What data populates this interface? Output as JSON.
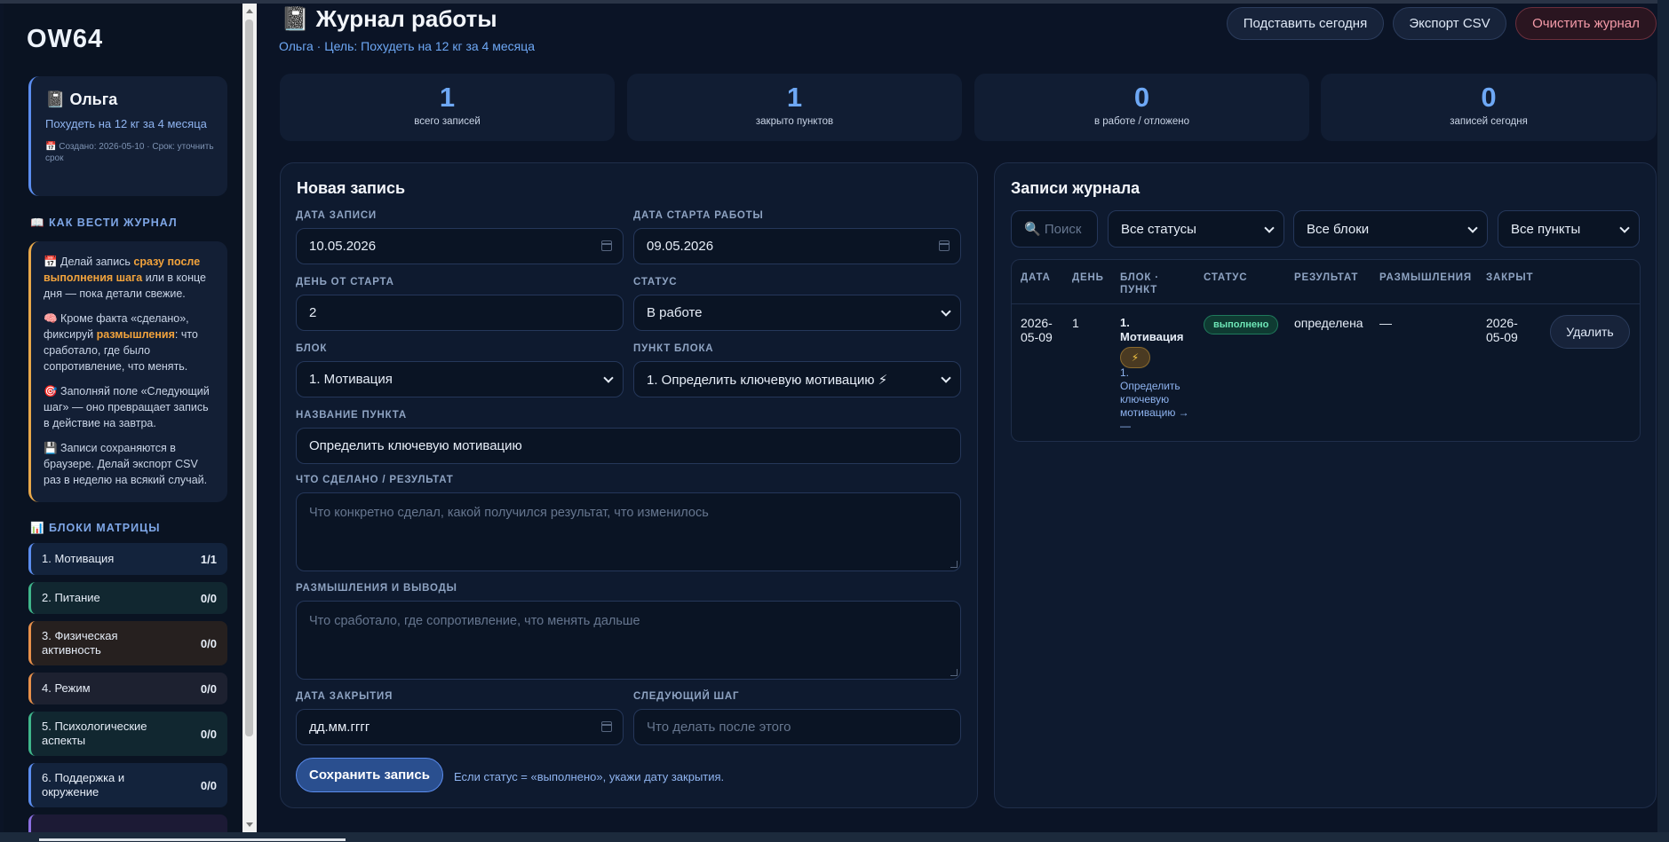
{
  "sidebar": {
    "brand": "OW64",
    "profile": {
      "icon": "📓",
      "name": "Ольга",
      "goal": "Похудеть на 12 кг за 4 месяца",
      "meta": "📅 Создано: 2026-05-10 · Срок: уточнить срок"
    },
    "howto_title": "📖 КАК ВЕСТИ ЖУРНАЛ",
    "tips": [
      {
        "pre": "📅 Делай запись ",
        "bold": "сразу после выполнения шага",
        "post": " или в конце дня — пока детали свежие."
      },
      {
        "pre": "🧠 Кроме факта «сделано», фиксируй ",
        "bold": "размышления",
        "post": ": что сработало, где было сопротивление, что менять."
      },
      {
        "pre": "🎯 Заполняй поле «Следующий шаг» — оно превращает запись в действие на завтра.",
        "bold": "",
        "post": ""
      },
      {
        "pre": "💾 Записи сохраняются в браузере. Делай экспорт CSV раз в неделю на всякий случай.",
        "bold": "",
        "post": ""
      }
    ],
    "blocks_title": "📊 БЛОКИ МАТРИЦЫ",
    "blocks": [
      {
        "label": "1. Мотивация",
        "count": "1/1",
        "color": "#5b8def",
        "bg": "#13233c"
      },
      {
        "label": "2. Питание",
        "count": "0/0",
        "color": "#3fb68b",
        "bg": "#112730"
      },
      {
        "label": "3. Физическая активность",
        "count": "0/0",
        "color": "#e8904a",
        "bg": "#26201f"
      },
      {
        "label": "4. Режим",
        "count": "0/0",
        "color": "#e8904a",
        "bg": "#1d2130"
      },
      {
        "label": "5. Психологические аспекты",
        "count": "0/0",
        "color": "#3fb68b",
        "bg": "#112730"
      },
      {
        "label": "6. Поддержка и окружение",
        "count": "0/0",
        "color": "#5b8def",
        "bg": "#13233c"
      }
    ]
  },
  "header": {
    "title": "📓 Журнал работы",
    "subtitle": "Ольга · Цель: Похудеть на 12 кг за 4 месяца",
    "btn_today": "Подставить сегодня",
    "btn_export": "Экспорт CSV",
    "btn_clear": "Очистить журнал"
  },
  "stats": [
    {
      "value": "1",
      "label": "всего записей"
    },
    {
      "value": "1",
      "label": "закрыто пунктов"
    },
    {
      "value": "0",
      "label": "в работе / отложено"
    },
    {
      "value": "0",
      "label": "записей сегодня"
    }
  ],
  "form": {
    "title": "Новая запись",
    "date_label": "ДАТА ЗАПИСИ",
    "date_value": "10.05.2026",
    "start_label": "ДАТА СТАРТА РАБОТЫ",
    "start_value": "09.05.2026",
    "day_label": "ДЕНЬ ОТ СТАРТА",
    "day_value": "2",
    "status_label": "СТАТУС",
    "status_value": "В работе",
    "block_label": "БЛОК",
    "block_value": "1. Мотивация",
    "point_label": "ПУНКТ БЛОКА",
    "point_value": "1. Определить ключевую мотивацию ⚡",
    "name_label": "НАЗВАНИЕ ПУНКТА",
    "name_value": "Определить ключевую мотивацию",
    "result_label": "ЧТО СДЕЛАНО / РЕЗУЛЬТАТ",
    "result_placeholder": "Что конкретно сделал, какой получился результат, что изменилось",
    "reflect_label": "РАЗМЫШЛЕНИЯ И ВЫВОДЫ",
    "reflect_placeholder": "Что сработало, где сопротивление, что менять дальше",
    "close_label": "ДАТА ЗАКРЫТИЯ",
    "close_placeholder": "дд.мм.гггг",
    "next_label": "СЛЕДУЮЩИЙ ШАГ",
    "next_placeholder": "Что делать после этого",
    "save_label": "Сохранить запись",
    "save_hint": "Если статус = «выполнено», укажи дату закрытия."
  },
  "journal": {
    "title": "Записи журнала",
    "search_placeholder": "🔍 Поиск",
    "filter_status": "Все статусы",
    "filter_blocks": "Все блоки",
    "filter_points": "Все пункты",
    "columns": [
      "ДАТА",
      "ДЕНЬ",
      "БЛОК · ПУНКТ",
      "СТАТУС",
      "РЕЗУЛЬТАТ",
      "РАЗМЫШЛЕНИЯ",
      "ЗАКРЫТ"
    ],
    "rows": [
      {
        "date": "2026-05-09",
        "day": "1",
        "block": "1. Мотивация",
        "chip": "⚡",
        "point": "1. Определить ключевую мотивацию → —",
        "status": "выполнено",
        "result": "определена",
        "reflections": "—",
        "closed": "2026-05-09",
        "delete_label": "Удалить"
      }
    ]
  }
}
